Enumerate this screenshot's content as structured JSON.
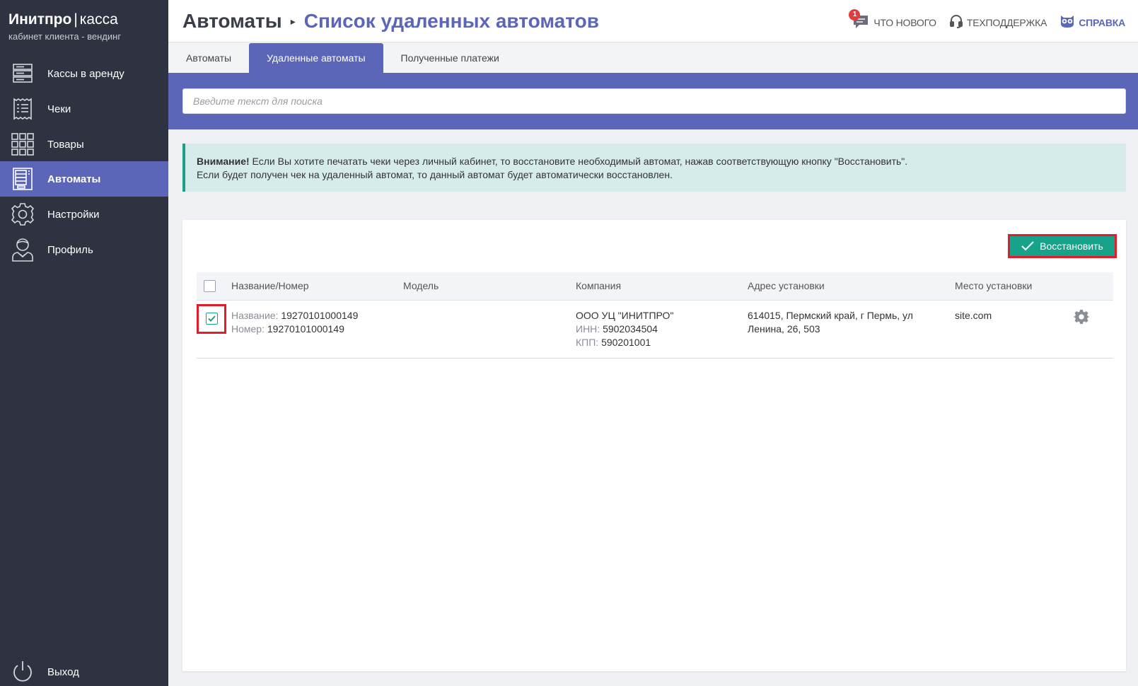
{
  "brand": {
    "name_bold": "Инитпро",
    "separator": "|",
    "name_light": "касса",
    "subtitle": "кабинет клиента - вендинг"
  },
  "sidebar": {
    "items": [
      {
        "label": "Кассы в аренду",
        "icon": "server-icon",
        "active": false
      },
      {
        "label": "Чеки",
        "icon": "receipt-icon",
        "active": false
      },
      {
        "label": "Товары",
        "icon": "grid-icon",
        "active": false
      },
      {
        "label": "Автоматы",
        "icon": "vending-machine-icon",
        "active": true
      },
      {
        "label": "Настройки",
        "icon": "gear-icon",
        "active": false
      },
      {
        "label": "Профиль",
        "icon": "user-icon",
        "active": false
      }
    ],
    "logout_label": "Выход"
  },
  "header": {
    "breadcrumb_root": "Автоматы",
    "breadcrumb_arrow": "▸",
    "breadcrumb_current": "Список удаленных автоматов",
    "links": {
      "whats_new": "ЧТО НОВОГО",
      "whats_new_badge": "1",
      "support": "ТЕХПОДДЕРЖКА",
      "help": "СПРАВКА"
    }
  },
  "tabs": [
    {
      "label": "Автоматы",
      "active": false
    },
    {
      "label": "Удаленные автоматы",
      "active": true
    },
    {
      "label": "Полученные платежи",
      "active": false
    }
  ],
  "search": {
    "placeholder": "Введите текст для поиска",
    "value": ""
  },
  "alert": {
    "title": "Внимание!",
    "line1": "Если Вы хотите печатать чеки через личный кабинет, то восстановите необходимый автомат, нажав соответствующую кнопку \"Восстановить\".",
    "line2": "Если будет получен чек на удаленный автомат, то данный автомат будет автоматически восстановлен."
  },
  "toolbar": {
    "restore_label": "Восстановить"
  },
  "table": {
    "columns": [
      "Название/Номер",
      "Модель",
      "Компания",
      "Адрес установки",
      "Место установки"
    ],
    "rows": [
      {
        "checked": true,
        "name_label": "Название:",
        "name_value": "19270101000149",
        "number_label": "Номер:",
        "number_value": "19270101000149",
        "model": "",
        "company": "ООО УЦ \"ИНИТПРО\"",
        "inn_label": "ИНН:",
        "inn_value": "5902034504",
        "kpp_label": "КПП:",
        "kpp_value": "590201001",
        "address_line1": "614015, Пермский край, г Пермь, ул",
        "address_line2": "Ленина, 26, 503",
        "place": "site.com"
      }
    ]
  },
  "colors": {
    "sidebar_bg": "#2f3240",
    "accent": "#5c66b8",
    "success": "#17a28a",
    "alert_bg": "#d6ecea",
    "highlight_red": "#e11d2b",
    "badge_red": "#e23c3c"
  }
}
